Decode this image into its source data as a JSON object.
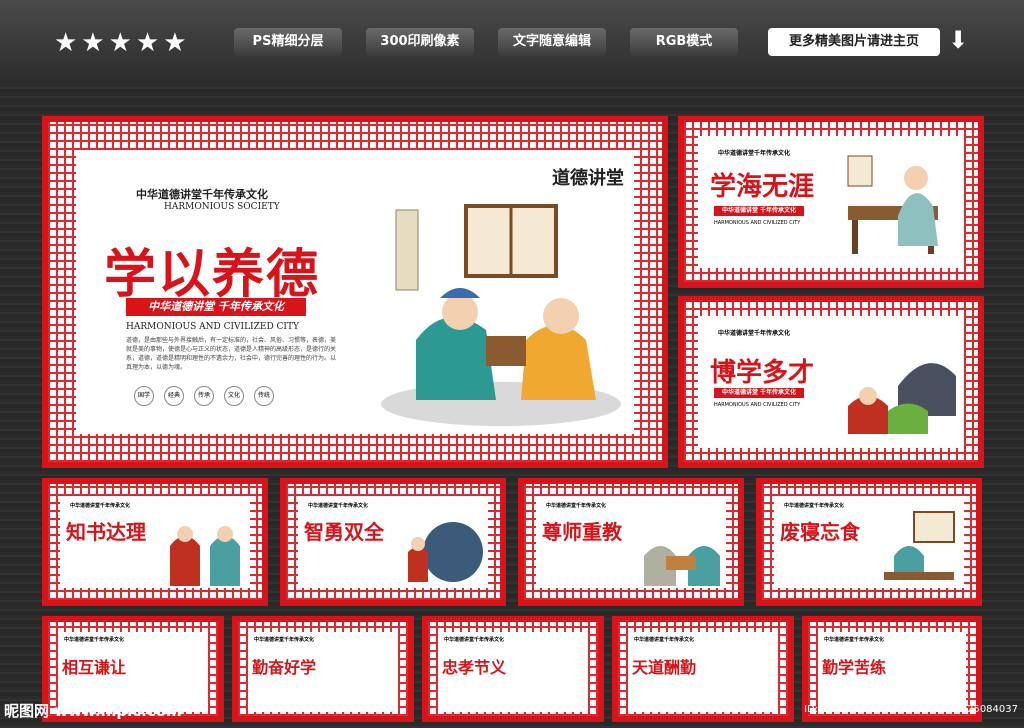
{
  "topbar": {
    "stars": "★★★★★",
    "buttons": [
      {
        "label": "PS精细分层"
      },
      {
        "label": "300印刷像素"
      },
      {
        "label": "文字随意编辑"
      },
      {
        "label": "RGB模式"
      }
    ],
    "more_label": "更多精美图片请进主页",
    "arrow": "⬇"
  },
  "main_board": {
    "heading": "中华道德讲堂千年传承文化",
    "heading_en": "HARMONIOUS SOCIETY",
    "title": "学以养德",
    "ribbon": "中华道德讲堂 千年传承文化",
    "subtitle_en": "HARMONIOUS AND CIVILIZED CITY",
    "body": "道德，是由那些与外界接触后，有一定标准的，社会、风俗、习惯等，表德，美就是美的事物，使德是心与正义的状态，道德是人精神的高级形态，是德行的关系，道德，道德是精明和理性的不遗余力，社会中，德行完善的理性的行为。以真理为本，以德为魂。",
    "circles": [
      "国学",
      "经典",
      "传承",
      "文化",
      "传统"
    ],
    "logo": "道德讲堂"
  },
  "boards": [
    {
      "title": "学海无涯",
      "heading": "中华道德讲堂千年传承文化",
      "heading_en": "HARMONIOUS SOCIETY",
      "ribbon": "中华道德讲堂 千年传承文化",
      "sub_en": "HARMONIOUS AND CIVILIZED CITY"
    },
    {
      "title": "博学多才",
      "heading": "中华道德讲堂千年传承文化",
      "heading_en": "HARMONIOUS SOCIETY",
      "ribbon": "中华道德讲堂 千年传承文化",
      "sub_en": "HARMONIOUS AND CIVILIZED CITY"
    },
    {
      "title": "知书达理",
      "heading": "中华道德讲堂千年传承文化"
    },
    {
      "title": "智勇双全",
      "heading": "中华道德讲堂千年传承文化"
    },
    {
      "title": "尊师重教",
      "heading": "中华道德讲堂千年传承文化"
    },
    {
      "title": "废寝忘食",
      "heading": "中华道德讲堂千年传承文化"
    },
    {
      "title": "相互谦让",
      "heading": "中华道德讲堂千年传承文化"
    },
    {
      "title": "勤奋好学",
      "heading": "中华道德讲堂千年传承文化"
    },
    {
      "title": "忠孝节义",
      "heading": "中华道德讲堂千年传承文化"
    },
    {
      "title": "天道酬勤",
      "heading": "中华道德讲堂千年传承文化"
    },
    {
      "title": "勤学苦练",
      "heading": "中华道德讲堂千年传承文化"
    }
  ],
  "watermark": {
    "left": "昵图网 www.nipic.com",
    "right": "ID:26956709 NO:20190404081025084037"
  },
  "colors": {
    "accent": "#d8141a",
    "background": "#2a2a2a"
  }
}
